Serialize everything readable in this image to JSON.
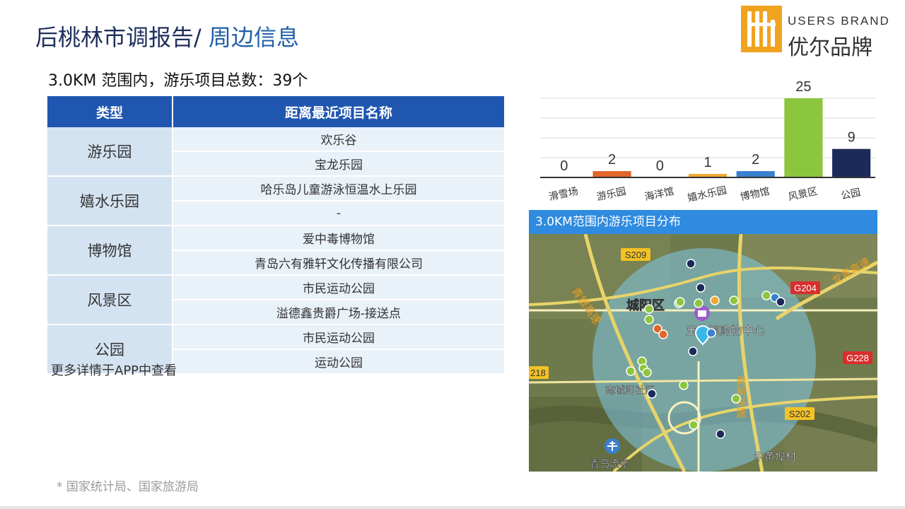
{
  "header": {
    "title_main": "后桃林市调报告/ ",
    "title_accent": "周边信息"
  },
  "logo": {
    "brand_en": "USERS BRAND",
    "brand_cn": "优尔品牌"
  },
  "subtitle": "3.0KM 范围内，游乐项目总数：39个",
  "table": {
    "headers": [
      "类型",
      "距离最近项目名称"
    ],
    "groups": [
      {
        "category": "游乐园",
        "items": [
          "欢乐谷",
          "宝龙乐园"
        ]
      },
      {
        "category": "嬉水乐园",
        "items": [
          "哈乐岛儿童游泳恒温水上乐园",
          "-"
        ]
      },
      {
        "category": "博物馆",
        "items": [
          "爱中毒博物馆",
          "青岛六有雅轩文化传播有限公司"
        ]
      },
      {
        "category": "风景区",
        "items": [
          "市民运动公园",
          "溢德鑫贵爵广场-接送点"
        ]
      },
      {
        "category": "公园",
        "items": [
          "市民运动公园",
          "运动公园"
        ]
      }
    ]
  },
  "note": "更多详情于APP中查看",
  "source": "* 国家统计局、国家旅游局",
  "chart_data": {
    "type": "bar",
    "title": "",
    "xlabel": "",
    "ylabel": "",
    "categories": [
      "滑雪场",
      "游乐园",
      "海洋馆",
      "嬉水乐园",
      "博物馆",
      "风景区",
      "公园"
    ],
    "values": [
      0,
      2,
      0,
      1,
      2,
      25,
      9
    ],
    "colors": [
      "#2a3a6a",
      "#e0662a",
      "#2a3a6a",
      "#f0a830",
      "#3a80cf",
      "#8cc63f",
      "#1c2a5a"
    ],
    "ylim": [
      0,
      25
    ],
    "grid": true,
    "legend": "none"
  },
  "map": {
    "title": "3.0KM范围内游乐项目分布",
    "labels": {
      "district_main": "城阳区",
      "district_south": "南城阳社区",
      "mall": "宝佳源购物中心",
      "airport": "青岛流亭",
      "village": "中黄埠村",
      "expressway_west": "青银高速",
      "expressway_east": "龙青高速",
      "expressway_mid": "青新高速"
    },
    "road_shields": {
      "s209": "S209",
      "g204": "G204",
      "g228": "G228",
      "s202": "S202",
      "r218": "218"
    },
    "legend_colors": {
      "scenic": "#8cc63f",
      "park": "#1c2a5a",
      "amusement": "#e0662a",
      "water": "#f0a830",
      "museum": "#3a80cf"
    }
  }
}
